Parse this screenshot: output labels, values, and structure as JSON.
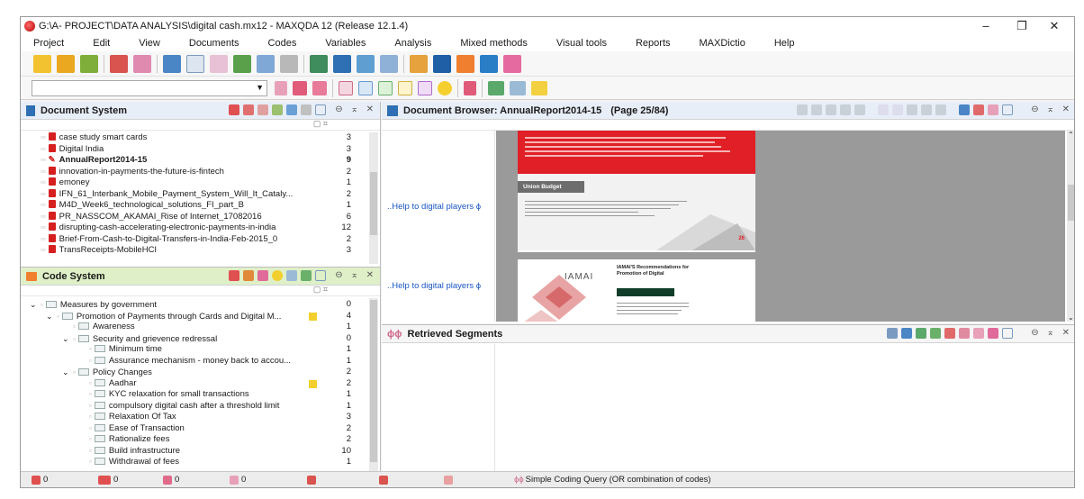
{
  "window": {
    "title": "G:\\A- PROJECT\\DATA ANALYSIS\\digital cash.mx12 - MAXQDA 12 (Release 12.1.4)",
    "minimize": "–",
    "restore": "❐",
    "close": "✕"
  },
  "menu": [
    "Project",
    "Edit",
    "View",
    "Documents",
    "Codes",
    "Variables",
    "Analysis",
    "Mixed methods",
    "Visual tools",
    "Reports",
    "MAXDictio",
    "Help"
  ],
  "document_system": {
    "title": "Document System",
    "window_buttons": "⊖ ⌅ ✕",
    "documents": [
      {
        "name": "case study smart cards",
        "count": "3",
        "bold": false
      },
      {
        "name": "Digital India",
        "count": "3",
        "bold": false
      },
      {
        "name": "AnnualReport2014-15",
        "count": "9",
        "bold": true
      },
      {
        "name": "innovation-in-payments-the-future-is-fintech",
        "count": "2",
        "bold": false
      },
      {
        "name": "emoney",
        "count": "1",
        "bold": false
      },
      {
        "name": "IFN_61_Interbank_Mobile_Payment_System_Will_It_Cataly...",
        "count": "2",
        "bold": false
      },
      {
        "name": "M4D_Week6_technological_solutions_FI_part_B",
        "count": "1",
        "bold": false
      },
      {
        "name": "PR_NASSCOM_AKAMAI_Rise of Internet_17082016",
        "count": "6",
        "bold": false
      },
      {
        "name": "disrupting-cash-accelerating-electronic-payments-in-india",
        "count": "12",
        "bold": false
      },
      {
        "name": "Brief-From-Cash-to-Digital-Transfers-in-India-Feb-2015_0",
        "count": "2",
        "bold": false
      },
      {
        "name": "TransReceipts-MobileHCI",
        "count": "3",
        "bold": false
      }
    ]
  },
  "code_system": {
    "title": "Code System",
    "window_buttons": "⊖ ⌅ ✕",
    "codes": [
      {
        "indent": 0,
        "exp": "⌄",
        "name": "Measures by government",
        "count": "0",
        "marker": false
      },
      {
        "indent": 1,
        "exp": "⌄",
        "name": "Promotion of Payments through Cards and Digital M...",
        "count": "4",
        "marker": true
      },
      {
        "indent": 2,
        "exp": "",
        "name": "Awareness",
        "count": "1",
        "marker": false
      },
      {
        "indent": 2,
        "exp": "⌄",
        "name": "Security and grievence redressal",
        "count": "0",
        "marker": false
      },
      {
        "indent": 3,
        "exp": "",
        "name": "Minimum time",
        "count": "1",
        "marker": false
      },
      {
        "indent": 3,
        "exp": "",
        "name": "Assurance mechanism - money back to accou...",
        "count": "1",
        "marker": false
      },
      {
        "indent": 2,
        "exp": "⌄",
        "name": "Policy Changes",
        "count": "2",
        "marker": false
      },
      {
        "indent": 3,
        "exp": "",
        "name": "Aadhar",
        "count": "2",
        "marker": true
      },
      {
        "indent": 3,
        "exp": "",
        "name": "KYC relaxation for small transactions",
        "count": "1",
        "marker": false
      },
      {
        "indent": 3,
        "exp": "",
        "name": "compulsory digital cash after a threshold limit",
        "count": "1",
        "marker": false
      },
      {
        "indent": 3,
        "exp": "",
        "name": "Relaxation Of Tax",
        "count": "3",
        "marker": false
      },
      {
        "indent": 3,
        "exp": "",
        "name": "Ease of Transaction",
        "count": "2",
        "marker": false
      },
      {
        "indent": 3,
        "exp": "",
        "name": "Rationalize fees",
        "count": "2",
        "marker": false
      },
      {
        "indent": 3,
        "exp": "",
        "name": "Build infrastructure",
        "count": "10",
        "marker": false
      },
      {
        "indent": 3,
        "exp": "",
        "name": "Withdrawal of fees",
        "count": "1",
        "marker": false
      }
    ]
  },
  "document_browser": {
    "title": "Document Browser: AnnualReport2014-15",
    "page": "(Page 25/84)",
    "window_buttons": "⊖ ⌅ ✕",
    "margin_codes": [
      "..Help to digital players",
      "..Help to digital players"
    ],
    "page_content": {
      "section_title": "Union Budget",
      "page_number": "26",
      "logo": "IAMAI",
      "recommendations_title": "IAMAI'S Recommendations for Promotion of Digital"
    }
  },
  "retrieved_segments": {
    "title": "Retrieved Segments",
    "window_buttons": "⊖ ⌅ ✕"
  },
  "status_bar": {
    "items": [
      {
        "icon": "document-icon",
        "value": "0"
      },
      {
        "icon": "code-icon",
        "value": "0"
      },
      {
        "icon": "activate-icon",
        "value": "0"
      },
      {
        "icon": "weight-icon",
        "value": "0"
      }
    ],
    "query": "Simple Coding Query (OR combination of codes)"
  },
  "colors": {
    "doc_header_bg": "#e8eef7",
    "code_header_bg": "#dff0c8",
    "pdf_red": "#d62020",
    "page_red": "#e01f26",
    "link_blue": "#1a56c4",
    "code_marker": "#f3cf2e"
  }
}
